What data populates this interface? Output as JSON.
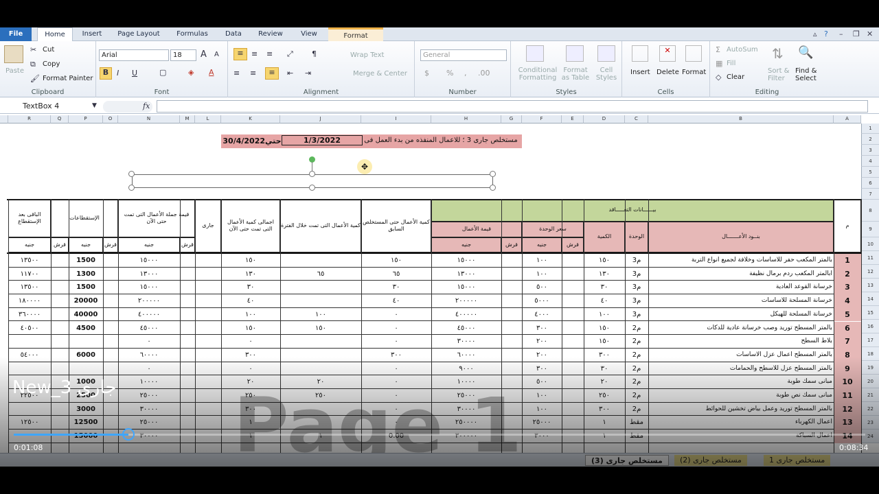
{
  "tabs": {
    "file": "File",
    "home": "Home",
    "insert": "Insert",
    "page_layout": "Page Layout",
    "formulas": "Formulas",
    "data": "Data",
    "review": "Review",
    "view": "View",
    "format": "Format"
  },
  "ribbon": {
    "clipboard": {
      "label": "Clipboard",
      "paste": "Paste",
      "cut": "Cut",
      "copy": "Copy",
      "painter": "Format Painter"
    },
    "font": {
      "label": "Font",
      "name": "Arial",
      "size": "18"
    },
    "alignment": {
      "label": "Alignment",
      "wrap": "Wrap Text",
      "merge": "Merge & Center"
    },
    "number": {
      "label": "Number",
      "format": "General"
    },
    "styles": {
      "label": "Styles",
      "conditional": "Conditional Formatting",
      "table": "Format as Table",
      "cell": "Cell Styles"
    },
    "cells": {
      "label": "Cells",
      "insert": "Insert",
      "delete": "Delete",
      "format": "Format"
    },
    "editing": {
      "label": "Editing",
      "autosum": "AutoSum",
      "fill": "Fill",
      "clear": "Clear",
      "sort": "Sort & Filter",
      "find": "Find & Select"
    }
  },
  "namebox": "TextBox 4",
  "fx": "fx",
  "columns": [
    "R",
    "Q",
    "P",
    "O",
    "N",
    "M",
    "L",
    "K",
    "J",
    "I",
    "H",
    "G",
    "F",
    "E",
    "D",
    "C",
    "B",
    "A"
  ],
  "title": {
    "left": "30/4/2022حتي",
    "mid": "1/3/2022",
    "right": "مستخلص جارى 3 ؛ للاعمال المنفذه من بدء العمل فى"
  },
  "headers": {
    "item": "م",
    "items": "بنــود الأعـــــــال",
    "unit": "الوحدة",
    "qty": "الكمية",
    "contract": "بيــــــانات التعـــــاقد",
    "unit_price": "سعر الوحدة",
    "value": "قيمة الأعمال",
    "prev_qty": "كمية الأعمال حتى المستخلص السابق",
    "period_qty": "كمية الأعمال التى تمت خلال الفترة",
    "total_qty": "اجمالى كمية الأعمال التى تمت حتى الآن",
    "current": "جارى",
    "total_value": "قيمة جملة الأعمال التى تمت حتى الآن",
    "deductions": "الإستقطاعات",
    "remaining": "الباقى بعد الإستقطاع",
    "pound": "جنيه",
    "piaster": "قرش"
  },
  "rows": [
    {
      "n": "1",
      "item": "بالمتر المكعب حفر للاساسات وخلافة لجميع انواع التربة",
      "unit": "م3",
      "qty": "١٥٠",
      "price": "١٠٠",
      "value": "١٥٠٠٠",
      "prev": "١٥٠",
      "period": "",
      "total": "١٥٠",
      "tval": "١٥٠٠٠",
      "ded": "1500",
      "rem": "١٣٥٠٠"
    },
    {
      "n": "2",
      "item": "ابالمتر المكعب ردم برمال نظيفة",
      "unit": "م3",
      "qty": "١٣٠",
      "price": "١٠٠",
      "value": "١٣٠٠٠",
      "prev": "٦٥",
      "period": "٦٥",
      "total": "١٣٠",
      "tval": "١٣٠٠٠",
      "ded": "1300",
      "rem": "١١٧٠٠"
    },
    {
      "n": "3",
      "item": "خرسانة القوعد العادية",
      "unit": "م3",
      "qty": "٣٠",
      "price": "٥٠٠",
      "value": "١٥٠٠٠",
      "prev": "٣٠",
      "period": "",
      "total": "٣٠",
      "tval": "١٥٠٠٠",
      "ded": "1500",
      "rem": "١٣٥٠٠"
    },
    {
      "n": "4",
      "item": "خرسانة المسلحة للاساسات",
      "unit": "م3",
      "qty": "٤٠",
      "price": "٥٠٠٠",
      "value": "٢٠٠٠٠٠",
      "prev": "٤٠",
      "period": "",
      "total": "٤٠",
      "tval": "٢٠٠٠٠٠",
      "ded": "20000",
      "rem": "١٨٠٠٠٠"
    },
    {
      "n": "5",
      "item": "خرسانة المسلحة للهيكل",
      "unit": "م3",
      "qty": "١٠٠",
      "price": "٤٠٠٠",
      "value": "٤٠٠٠٠٠",
      "prev": "٠",
      "period": "١٠٠",
      "total": "١٠٠",
      "tval": "٤٠٠٠٠٠",
      "ded": "40000",
      "rem": "٣٦٠٠٠٠"
    },
    {
      "n": "6",
      "item": "بالمتر المسطح توريد وصب خرسانة عادية للدكات",
      "unit": "م2",
      "qty": "١٥٠",
      "price": "٣٠٠",
      "value": "٤٥٠٠٠",
      "prev": "٠",
      "period": "١٥٠",
      "total": "١٥٠",
      "tval": "٤٥٠٠٠",
      "ded": "4500",
      "rem": "٤٠٥٠٠"
    },
    {
      "n": "7",
      "item": "بلاط السطح",
      "unit": "م2",
      "qty": "١٥٠",
      "price": "٢٠٠",
      "value": "٣٠٠٠٠",
      "prev": "٠",
      "period": "",
      "total": "٠",
      "tval": "٠",
      "ded": "",
      "rem": ""
    },
    {
      "n": "8",
      "item": "بالمتر المسطح اعمال عزل الاساسات",
      "unit": "م2",
      "qty": "٣٠٠",
      "price": "٢٠٠",
      "value": "٦٠٠٠٠",
      "prev": "٣٠٠",
      "period": "",
      "total": "٣٠٠",
      "tval": "٦٠٠٠٠",
      "ded": "6000",
      "rem": "٥٤٠٠٠"
    },
    {
      "n": "9",
      "item": "بالمتر المسطح عزل للاسطح والحمامات",
      "unit": "م2",
      "qty": "٣٠",
      "price": "٣٠٠",
      "value": "٩٠٠٠",
      "prev": "٠",
      "period": "",
      "total": "٠",
      "tval": "٠",
      "ded": "",
      "rem": ""
    },
    {
      "n": "10",
      "item": "مبانى سمك طوبة",
      "unit": "م2",
      "qty": "٢٠",
      "price": "٥٠٠",
      "value": "١٠٠٠٠",
      "prev": "٠",
      "period": "٢٠",
      "total": "٢٠",
      "tval": "١٠٠٠٠",
      "ded": "1000",
      "rem": ""
    },
    {
      "n": "11",
      "item": "مبانى سمك نص طوبة",
      "unit": "م2",
      "qty": "٢٥٠",
      "price": "١٠٠",
      "value": "٢٥٠٠٠",
      "prev": "٠",
      "period": "٢٥٠",
      "total": "٢٥٠",
      "tval": "٢٥٠٠٠",
      "ded": "2500",
      "rem": "٢٢٥٠٠"
    },
    {
      "n": "12",
      "item": "بالمتر المسطح توريد وعمل بياض تخشين للحوائط",
      "unit": "م2",
      "qty": "٣٠٠",
      "price": "١٠٠",
      "value": "٣٠٠٠٠",
      "prev": "٠",
      "period": "",
      "total": "٣٠٠",
      "tval": "٣٠٠٠٠",
      "ded": "3000",
      "rem": ""
    },
    {
      "n": "13",
      "item": "اعمال الكهرباء",
      "unit": "مقط",
      "qty": "١",
      "price": "٢٥٠٠٠",
      "value": "٢٥٠٠٠٠",
      "prev": "٠",
      "period": "",
      "total": "١",
      "tval": "٢٥٠٠٠",
      "ded": "12500",
      "rem": "١٢٥٠٠"
    },
    {
      "n": "14",
      "item": "اعمال السباكة",
      "unit": "مقط",
      "qty": "١",
      "price": "٣٠٠٠",
      "value": "٣٠٠٠٠٠",
      "prev": "0.00",
      "period": "١",
      "total": "١",
      "tval": "٣٠٠٠٠",
      "ded": "15000",
      "rem": ""
    }
  ],
  "row_numbers": [
    "1",
    "2",
    "3",
    "4",
    "5",
    "6",
    "7",
    "8",
    "9",
    "10",
    "11",
    "12",
    "13",
    "14",
    "15",
    "16",
    "17",
    "18",
    "19",
    "20",
    "21",
    "22",
    "23",
    "24"
  ],
  "sheets": [
    "مستخلص جارى (3)",
    "مستخلص جارى (2)",
    "مستخلص جارى 1"
  ],
  "watermark": "Page 1",
  "video": {
    "title": "New_3 جارى",
    "elapsed": "0:01:08",
    "total": "0:08:34",
    "progress": 0.135
  },
  "colors": {
    "green": "#c3d69b",
    "pink": "#e6b8b7",
    "title_bg": "#e6a5a5",
    "accent": "#2b6fbd"
  }
}
